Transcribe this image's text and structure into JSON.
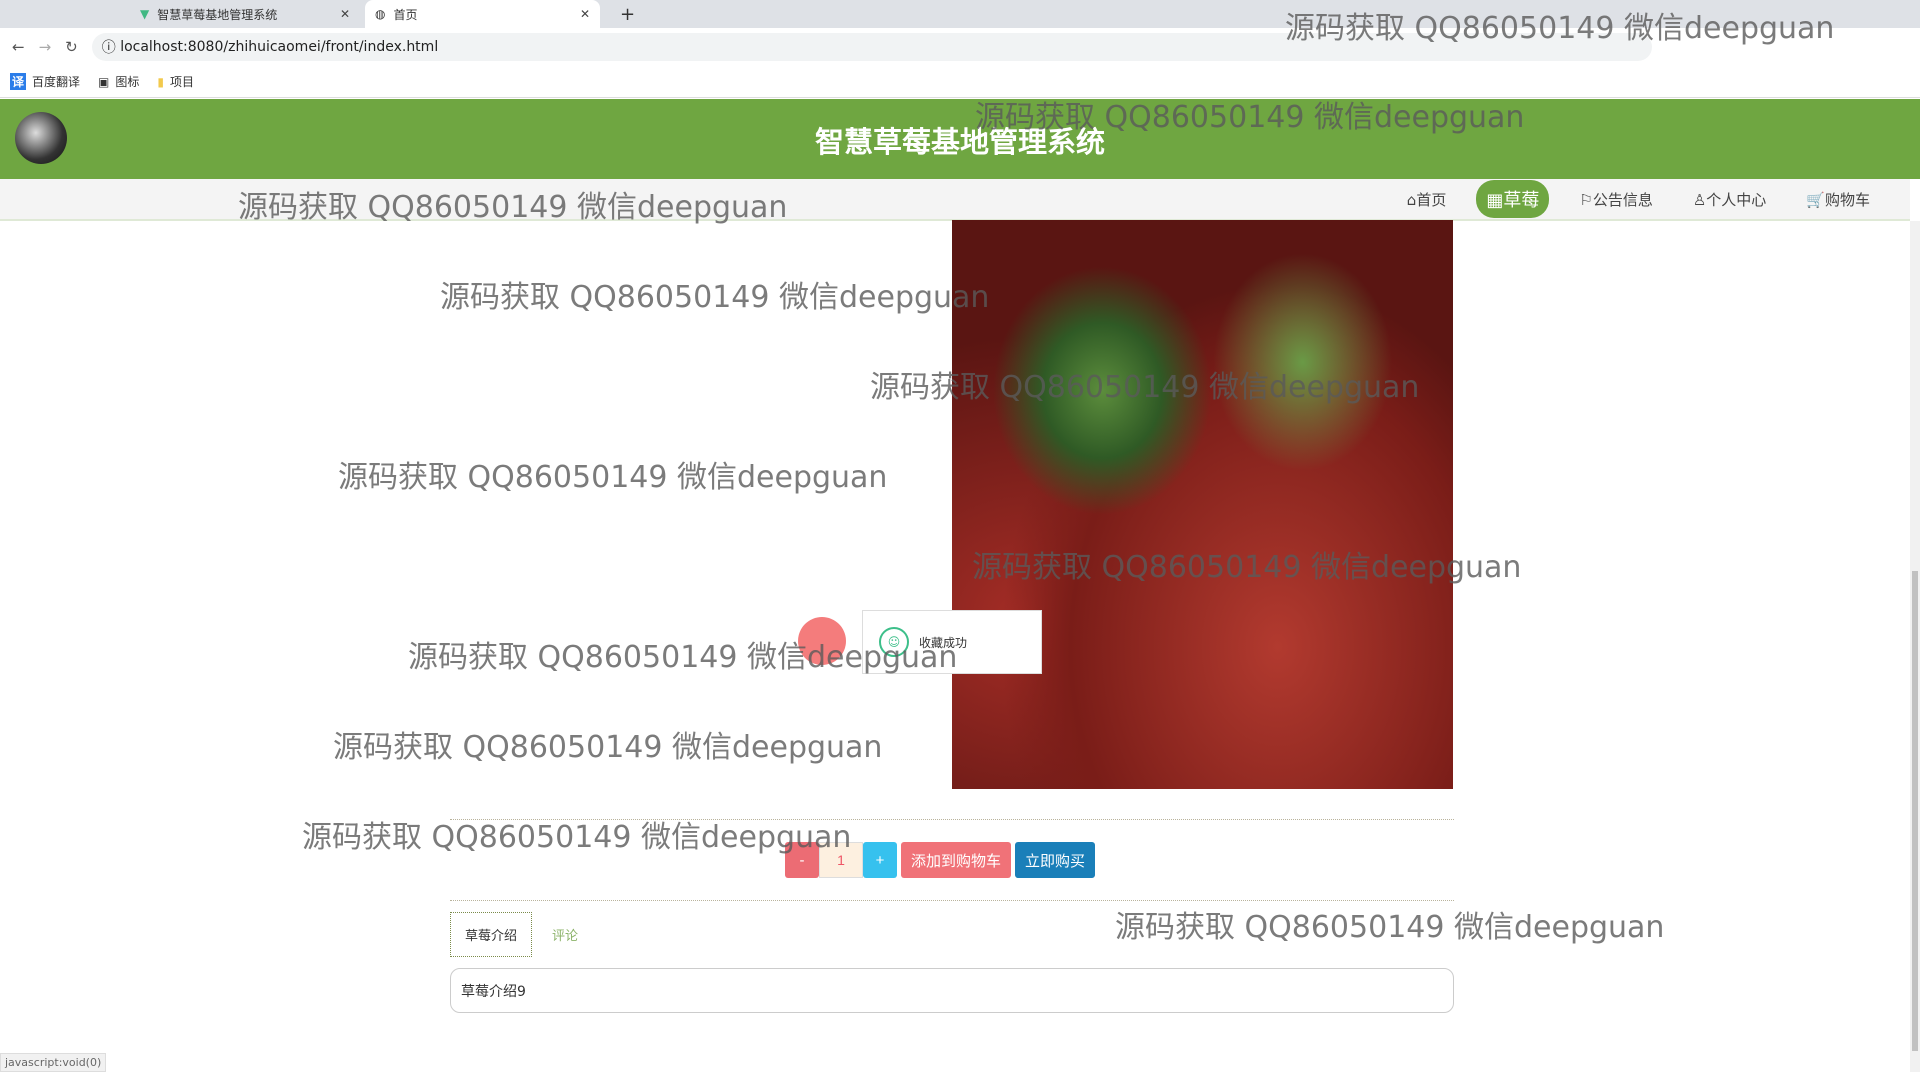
{
  "browser": {
    "tabs": [
      {
        "label": "智慧草莓基地管理系统"
      },
      {
        "label": "首页"
      }
    ],
    "url": "localhost:8080/zhihuicaomei/front/index.html",
    "bookmarks": [
      "百度翻译",
      "图标",
      "项目"
    ]
  },
  "header": {
    "title": "智慧草莓基地管理系统"
  },
  "nav": {
    "items": [
      "首页",
      "草莓",
      "公告信息",
      "个人中心",
      "购物车"
    ],
    "active": 1
  },
  "toast": {
    "message": "收藏成功"
  },
  "purchase": {
    "minus": "-",
    "quantity": "1",
    "plus": "+",
    "add_to_cart": "添加到购物车",
    "buy_now": "立即购买"
  },
  "detail_tabs": [
    "草莓介绍",
    "评论"
  ],
  "intro": "草莓介绍9",
  "watermark": "源码获取 QQ86050149 微信deepguan",
  "status": "javascript:void(0)",
  "colors": {
    "brand": "#6fa641"
  }
}
